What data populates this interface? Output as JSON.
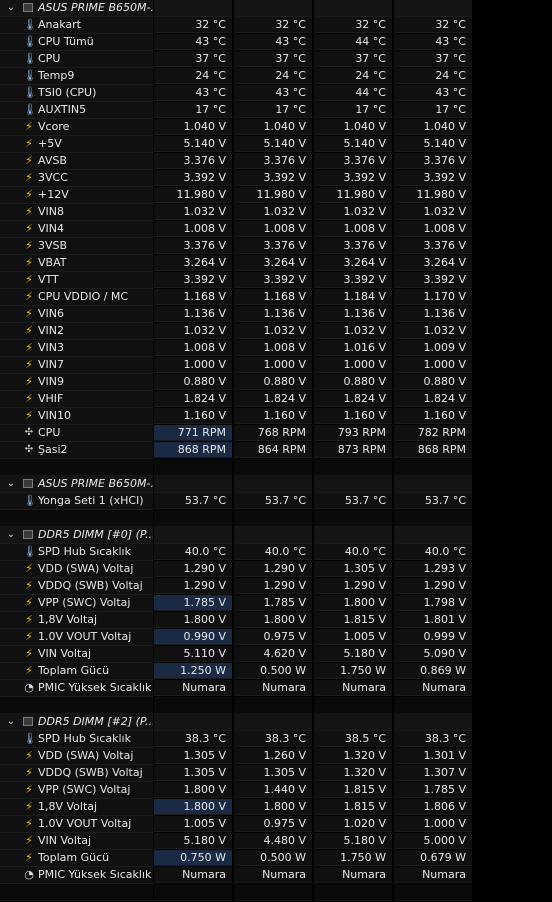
{
  "sections": [
    {
      "title": "ASUS PRIME B650M-...",
      "rows": [
        {
          "icon": "thermometer-icon",
          "label": "Anakart",
          "v": [
            "32 °C",
            "32 °C",
            "32 °C",
            "32 °C"
          ],
          "hl": []
        },
        {
          "icon": "thermometer-icon",
          "label": "CPU Tümü",
          "v": [
            "43 °C",
            "43 °C",
            "44 °C",
            "43 °C"
          ],
          "hl": []
        },
        {
          "icon": "thermometer-icon",
          "label": "CPU",
          "v": [
            "37 °C",
            "37 °C",
            "37 °C",
            "37 °C"
          ],
          "hl": []
        },
        {
          "icon": "thermometer-icon",
          "label": "Temp9",
          "v": [
            "24 °C",
            "24 °C",
            "24 °C",
            "24 °C"
          ],
          "hl": []
        },
        {
          "icon": "thermometer-icon",
          "label": "TSI0 (CPU)",
          "v": [
            "43 °C",
            "43 °C",
            "44 °C",
            "43 °C"
          ],
          "hl": []
        },
        {
          "icon": "thermometer-icon",
          "label": "AUXTIN5",
          "v": [
            "17 °C",
            "17 °C",
            "17 °C",
            "17 °C"
          ],
          "hl": []
        },
        {
          "icon": "lightning-icon",
          "label": "Vcore",
          "v": [
            "1.040 V",
            "1.040 V",
            "1.040 V",
            "1.040 V"
          ],
          "hl": []
        },
        {
          "icon": "lightning-icon",
          "label": "+5V",
          "v": [
            "5.140 V",
            "5.140 V",
            "5.140 V",
            "5.140 V"
          ],
          "hl": []
        },
        {
          "icon": "lightning-icon",
          "label": "AVSB",
          "v": [
            "3.376 V",
            "3.376 V",
            "3.376 V",
            "3.376 V"
          ],
          "hl": []
        },
        {
          "icon": "lightning-icon",
          "label": "3VCC",
          "v": [
            "3.392 V",
            "3.392 V",
            "3.392 V",
            "3.392 V"
          ],
          "hl": []
        },
        {
          "icon": "lightning-icon",
          "label": "+12V",
          "v": [
            "11.980 V",
            "11.980 V",
            "11.980 V",
            "11.980 V"
          ],
          "hl": []
        },
        {
          "icon": "lightning-icon",
          "label": "VIN8",
          "v": [
            "1.032 V",
            "1.032 V",
            "1.032 V",
            "1.032 V"
          ],
          "hl": []
        },
        {
          "icon": "lightning-icon",
          "label": "VIN4",
          "v": [
            "1.008 V",
            "1.008 V",
            "1.008 V",
            "1.008 V"
          ],
          "hl": []
        },
        {
          "icon": "lightning-icon",
          "label": "3VSB",
          "v": [
            "3.376 V",
            "3.376 V",
            "3.376 V",
            "3.376 V"
          ],
          "hl": []
        },
        {
          "icon": "lightning-icon",
          "label": "VBAT",
          "v": [
            "3.264 V",
            "3.264 V",
            "3.264 V",
            "3.264 V"
          ],
          "hl": []
        },
        {
          "icon": "lightning-icon",
          "label": "VTT",
          "v": [
            "3.392 V",
            "3.392 V",
            "3.392 V",
            "3.392 V"
          ],
          "hl": []
        },
        {
          "icon": "lightning-icon",
          "label": "CPU VDDIO / MC",
          "v": [
            "1.168 V",
            "1.168 V",
            "1.184 V",
            "1.170 V"
          ],
          "hl": []
        },
        {
          "icon": "lightning-icon",
          "label": "VIN6",
          "v": [
            "1.136 V",
            "1.136 V",
            "1.136 V",
            "1.136 V"
          ],
          "hl": []
        },
        {
          "icon": "lightning-icon",
          "label": "VIN2",
          "v": [
            "1.032 V",
            "1.032 V",
            "1.032 V",
            "1.032 V"
          ],
          "hl": []
        },
        {
          "icon": "lightning-icon",
          "label": "VIN3",
          "v": [
            "1.008 V",
            "1.008 V",
            "1.016 V",
            "1.009 V"
          ],
          "hl": []
        },
        {
          "icon": "lightning-icon",
          "label": "VIN7",
          "v": [
            "1.000 V",
            "1.000 V",
            "1.000 V",
            "1.000 V"
          ],
          "hl": []
        },
        {
          "icon": "lightning-icon",
          "label": "VIN9",
          "v": [
            "0.880 V",
            "0.880 V",
            "0.880 V",
            "0.880 V"
          ],
          "hl": []
        },
        {
          "icon": "lightning-icon",
          "label": "VHIF",
          "v": [
            "1.824 V",
            "1.824 V",
            "1.824 V",
            "1.824 V"
          ],
          "hl": []
        },
        {
          "icon": "lightning-icon",
          "label": "VIN10",
          "v": [
            "1.160 V",
            "1.160 V",
            "1.160 V",
            "1.160 V"
          ],
          "hl": []
        },
        {
          "icon": "fan-icon",
          "label": "CPU",
          "v": [
            "771 RPM",
            "768 RPM",
            "793 RPM",
            "782 RPM"
          ],
          "hl": [
            0
          ]
        },
        {
          "icon": "fan-icon",
          "label": "Şasi2",
          "v": [
            "868 RPM",
            "864 RPM",
            "873 RPM",
            "868 RPM"
          ],
          "hl": [
            0
          ]
        }
      ]
    },
    {
      "title": "ASUS PRIME B650M-...",
      "rows": [
        {
          "icon": "thermometer-icon",
          "label": "Yonga Seti 1 (xHCI)",
          "v": [
            "53.7 °C",
            "53.7 °C",
            "53.7 °C",
            "53.7 °C"
          ],
          "hl": []
        }
      ]
    },
    {
      "title": "DDR5 DIMM [#0] (P...",
      "rows": [
        {
          "icon": "thermometer-icon",
          "label": "SPD Hub Sıcaklık",
          "v": [
            "40.0 °C",
            "40.0 °C",
            "40.0 °C",
            "40.0 °C"
          ],
          "hl": []
        },
        {
          "icon": "lightning-icon",
          "label": "VDD (SWA) Voltaj",
          "v": [
            "1.290 V",
            "1.290 V",
            "1.305 V",
            "1.293 V"
          ],
          "hl": []
        },
        {
          "icon": "lightning-icon",
          "label": "VDDQ (SWB) Voltaj",
          "v": [
            "1.290 V",
            "1.290 V",
            "1.290 V",
            "1.290 V"
          ],
          "hl": []
        },
        {
          "icon": "lightning-icon",
          "label": "VPP (SWC) Voltaj",
          "v": [
            "1.785 V",
            "1.785 V",
            "1.800 V",
            "1.798 V"
          ],
          "hl": [
            0
          ]
        },
        {
          "icon": "lightning-icon",
          "label": "1,8V Voltaj",
          "v": [
            "1.800 V",
            "1.800 V",
            "1.815 V",
            "1.801 V"
          ],
          "hl": []
        },
        {
          "icon": "lightning-icon",
          "label": "1.0V VOUT Voltaj",
          "v": [
            "0.990 V",
            "0.975 V",
            "1.005 V",
            "0.999 V"
          ],
          "hl": [
            0
          ]
        },
        {
          "icon": "lightning-icon",
          "label": "VIN Voltaj",
          "v": [
            "5.110 V",
            "4.620 V",
            "5.180 V",
            "5.090 V"
          ],
          "hl": []
        },
        {
          "icon": "lightning-icon",
          "label": "Toplam Gücü",
          "v": [
            "1.250 W",
            "0.500 W",
            "1.750 W",
            "0.869 W"
          ],
          "hl": [
            0
          ]
        },
        {
          "icon": "gauge-icon",
          "label": "PMIC Yüksek Sıcaklık",
          "v": [
            "Numara",
            "Numara",
            "Numara",
            "Numara"
          ],
          "hl": []
        }
      ]
    },
    {
      "title": "DDR5 DIMM [#2] (P...",
      "rows": [
        {
          "icon": "thermometer-icon",
          "label": "SPD Hub Sıcaklık",
          "v": [
            "38.3 °C",
            "38.3 °C",
            "38.5 °C",
            "38.3 °C"
          ],
          "hl": []
        },
        {
          "icon": "lightning-icon",
          "label": "VDD (SWA) Voltaj",
          "v": [
            "1.305 V",
            "1.260 V",
            "1.320 V",
            "1.301 V"
          ],
          "hl": []
        },
        {
          "icon": "lightning-icon",
          "label": "VDDQ (SWB) Voltaj",
          "v": [
            "1.305 V",
            "1.305 V",
            "1.320 V",
            "1.307 V"
          ],
          "hl": []
        },
        {
          "icon": "lightning-icon",
          "label": "VPP (SWC) Voltaj",
          "v": [
            "1.800 V",
            "1.440 V",
            "1.815 V",
            "1.785 V"
          ],
          "hl": []
        },
        {
          "icon": "lightning-icon",
          "label": "1,8V Voltaj",
          "v": [
            "1.800 V",
            "1.800 V",
            "1.815 V",
            "1.806 V"
          ],
          "hl": [
            0
          ]
        },
        {
          "icon": "lightning-icon",
          "label": "1.0V VOUT Voltaj",
          "v": [
            "1.005 V",
            "0.975 V",
            "1.020 V",
            "1.000 V"
          ],
          "hl": []
        },
        {
          "icon": "lightning-icon",
          "label": "VIN Voltaj",
          "v": [
            "5.180 V",
            "4.480 V",
            "5.180 V",
            "5.000 V"
          ],
          "hl": []
        },
        {
          "icon": "lightning-icon",
          "label": "Toplam Gücü",
          "v": [
            "0.750 W",
            "0.500 W",
            "1.750 W",
            "0.679 W"
          ],
          "hl": [
            0
          ]
        },
        {
          "icon": "gauge-icon",
          "label": "PMIC Yüksek Sıcaklık",
          "v": [
            "Numara",
            "Numara",
            "Numara",
            "Numara"
          ],
          "hl": []
        }
      ]
    }
  ],
  "icons": {
    "thermometer-icon": "🌡",
    "lightning-icon": "⚡",
    "fan-icon": "✣",
    "gauge-icon": "◔",
    "collapse-icon": "⌄"
  },
  "colors": {
    "highlight": "#1b2a44",
    "lightning": "#f2c200",
    "thermometer": "#8fb6e6"
  }
}
